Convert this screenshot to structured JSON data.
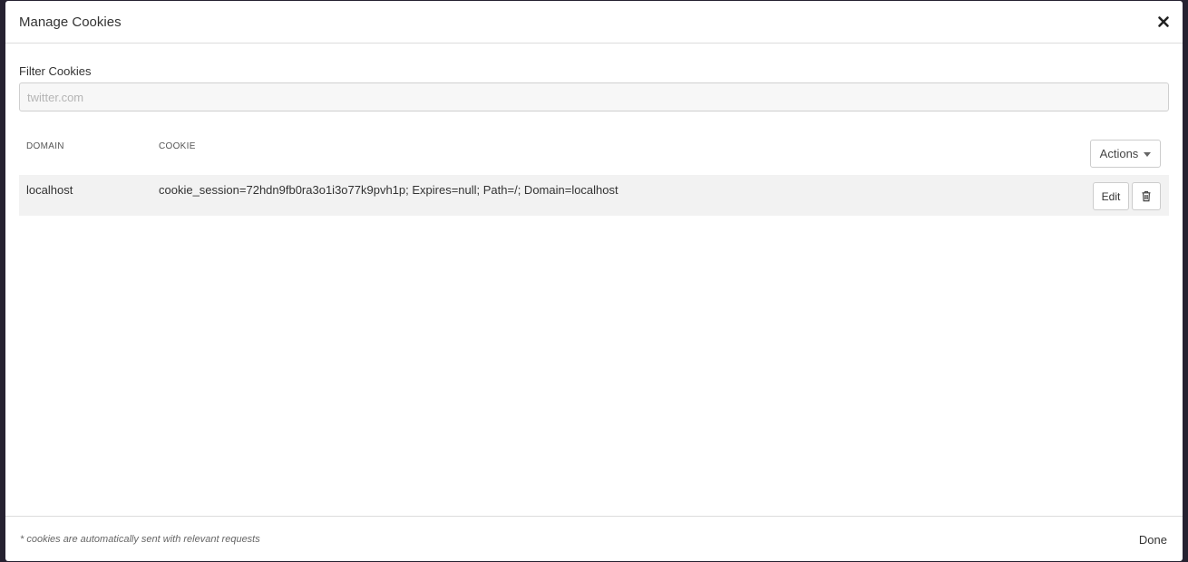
{
  "modal": {
    "title": "Manage Cookies",
    "close_icon": "close-icon"
  },
  "filter": {
    "label": "Filter Cookies",
    "placeholder": "twitter.com",
    "value": ""
  },
  "table": {
    "columns": [
      "DOMAIN",
      "COOKIE"
    ],
    "actions_label": "Actions",
    "rows": [
      {
        "domain": "localhost",
        "cookie": "cookie_session=72hdn9fb0ra3o1i3o77k9pvh1p; Expires=null; Path=/; Domain=localhost",
        "edit_label": "Edit",
        "delete_icon": "trash-icon"
      }
    ]
  },
  "footer": {
    "note": "* cookies are automatically sent with relevant requests",
    "done_label": "Done"
  },
  "colors": {
    "backdrop": "#262231",
    "row_bg": "#f2f2f2",
    "border": "#cccccc"
  }
}
